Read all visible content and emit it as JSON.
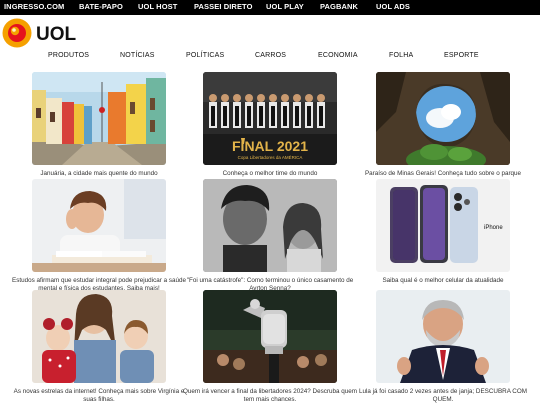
{
  "topbar": {
    "links": [
      "INGRESSO.COM",
      "BATE-PAPO",
      "UOL HOST",
      "PASSEI DIRETO",
      "UOL PLAY",
      "PAGBANK",
      "UOL ADS"
    ]
  },
  "logo": {
    "text": "UOL"
  },
  "nav": {
    "items": [
      "PRODUTOS",
      "NOTÍCIAS",
      "POLÍTICAS",
      "CARROS",
      "ECONOMIA",
      "FOLHA",
      "ESPORTE"
    ]
  },
  "cards": [
    {
      "caption": "Januária, a cidade mais quente do mundo",
      "image": "colorful-street-photo"
    },
    {
      "caption": "Conheça o melhor time do mundo",
      "image": "soccer-team-photo",
      "banner_title": "FINAL 2021",
      "banner_sub": "Copa Libertadores da AMÉRICA"
    },
    {
      "caption": "Paraíso de Minas Gerais! Conheça tudo sobre o parque",
      "image": "cave-sky-photo"
    },
    {
      "caption": "Estudos afirmam que estudar integral pode prejudicar a saúde mental e física dos estudantes. Saiba mais!",
      "image": "tired-student-photo"
    },
    {
      "caption": "\"Foi uma catástrofe\": Como terminou o único casamento de Ayrton Senna?",
      "image": "black-white-couple-photo"
    },
    {
      "caption": "Saiba qual é o melhor celular da atualidade",
      "image": "iphone-photo",
      "brand_label": "iPhone"
    },
    {
      "caption": "As novas estrelas da internet! Conheça mais sobre Virgínia e suas filhas.",
      "image": "mother-daughters-photo"
    },
    {
      "caption": "Quem irá vencer a final da libertadores 2024? Descruba quem tem mais chances.",
      "image": "trophy-photo"
    },
    {
      "caption": "Lula já foi casado 2 vezes antes de janja; DESCUBRA COM QUEM.",
      "image": "politician-photo"
    }
  ],
  "colors": {
    "topbar_bg": "#000000",
    "logo_orange": "#f5a000",
    "logo_red": "#e5131d",
    "page_bg": "#ffffff"
  }
}
